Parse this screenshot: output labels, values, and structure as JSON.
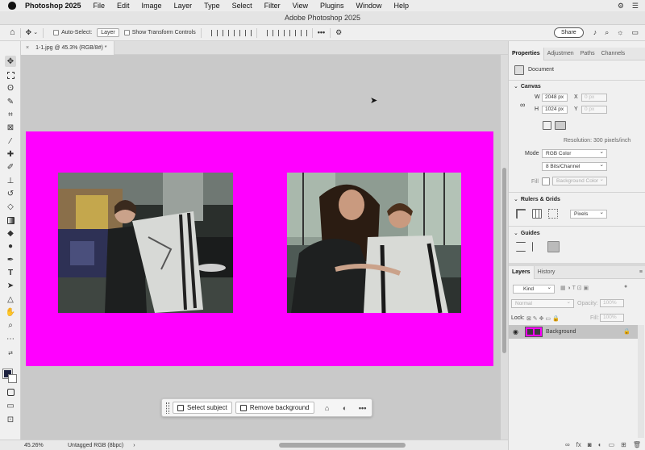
{
  "menubar": {
    "app": "Photoshop 2025",
    "items": [
      "File",
      "Edit",
      "Image",
      "Layer",
      "Type",
      "Select",
      "Filter",
      "View",
      "Plugins",
      "Window",
      "Help"
    ]
  },
  "window": {
    "title": "Adobe Photoshop 2025"
  },
  "options": {
    "auto_select_label": "Auto-Select:",
    "auto_select_value": "Layer",
    "transform_controls_label": "Show Transform Controls",
    "share_label": "Share"
  },
  "document": {
    "tab_title": "1-1.jpg @ 45.3% (RGB/8#) *",
    "close_glyph": "×",
    "background_color": "#ff00ff"
  },
  "context_bar": {
    "select_subject": "Select subject",
    "remove_background": "Remove background",
    "more": "•••"
  },
  "status": {
    "zoom": "45.26%",
    "profile": "Untagged RGB (8bpc)",
    "arrow": "›"
  },
  "properties": {
    "tabs": [
      "Properties",
      "Adjustmen",
      "Paths",
      "Channels"
    ],
    "doc_label": "Document",
    "canvas_header": "Canvas",
    "w_label": "W",
    "w_value": "2048 px",
    "h_label": "H",
    "h_value": "1024 px",
    "x_label": "X",
    "x_value": "0 px",
    "y_label": "Y",
    "y_value": "0 px",
    "resolution": "Resolution: 300 pixels/inch",
    "mode_label": "Mode",
    "mode_value": "RGB Color",
    "depth_value": "8 Bits/Channel",
    "fill_label": "Fill",
    "fill_value": "Background Color",
    "rulers_header": "Rulers & Grids",
    "units_value": "Pixels",
    "guides_header": "Guides"
  },
  "layers": {
    "tabs": [
      "Layers",
      "History"
    ],
    "kind_placeholder": "Kind",
    "blend_mode": "Normal",
    "opacity_label": "Opacity:",
    "opacity_value": "100%",
    "lock_label": "Lock:",
    "fill_label": "Fill:",
    "fill_value": "100%",
    "layer_name": "Background",
    "footer_icons": [
      "link-icon",
      "fx-icon",
      "mask-icon",
      "adjustment-icon",
      "folder-icon",
      "new-layer-icon",
      "trash-icon"
    ]
  }
}
